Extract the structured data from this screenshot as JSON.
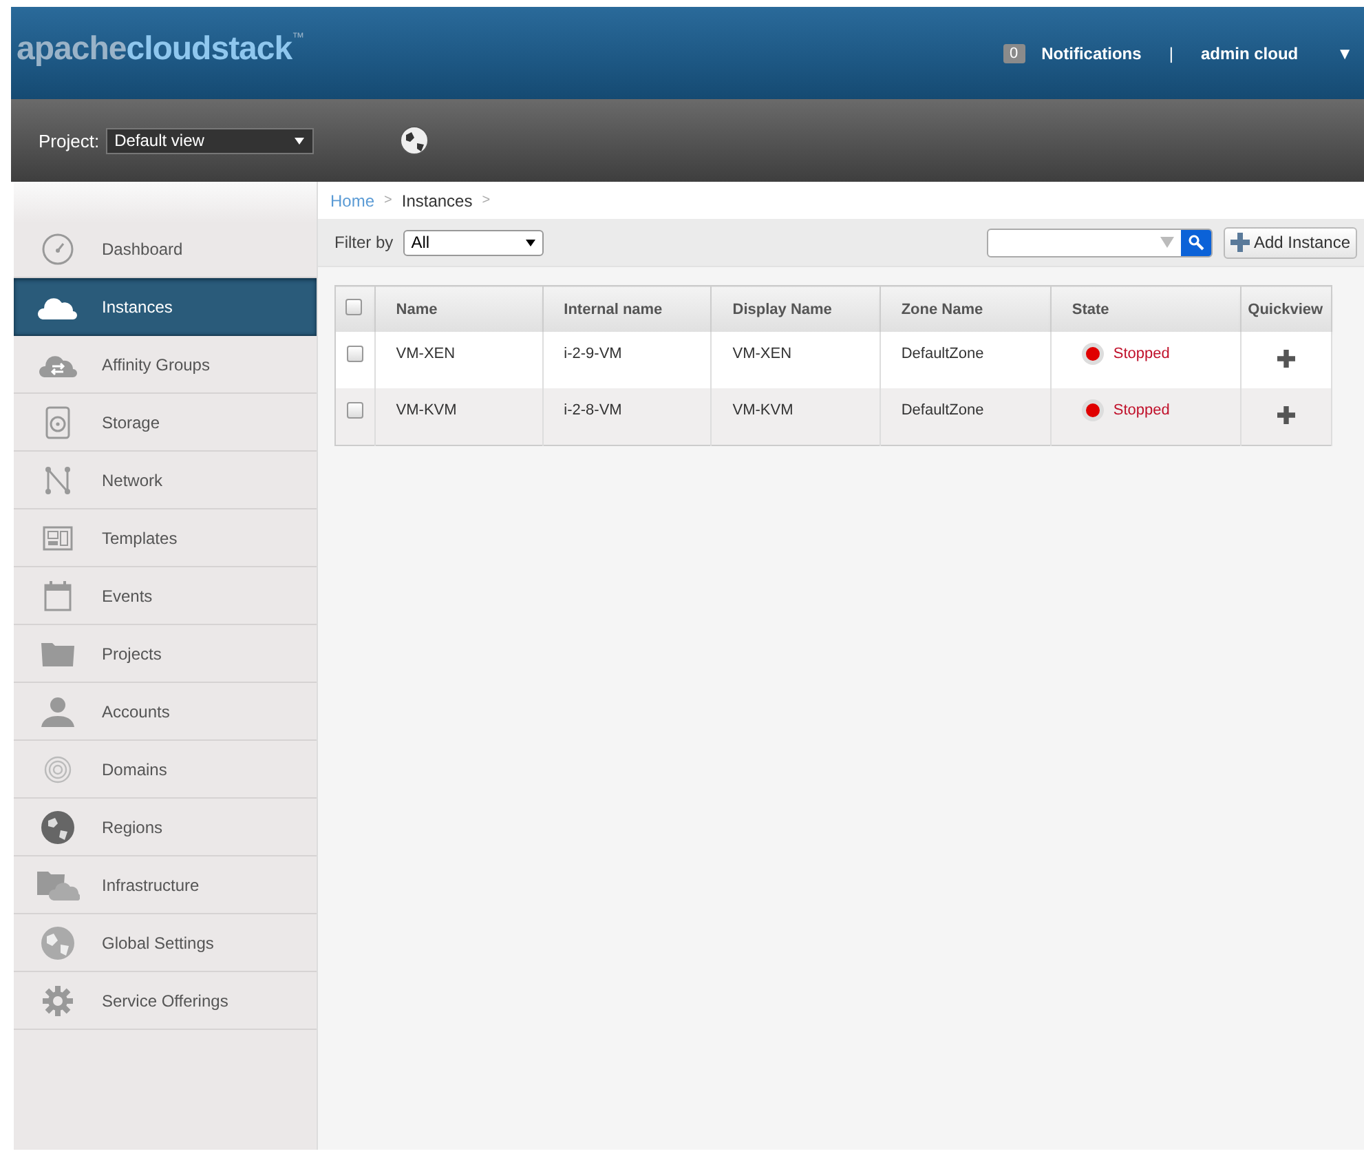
{
  "header": {
    "logo_light": "apache",
    "logo_bold": "cloudstack",
    "logo_mark": "™",
    "notification_count": "0",
    "notifications": "Notifications",
    "separator": "|",
    "user": "admin cloud",
    "menu_caret": "▼"
  },
  "project_bar": {
    "label": "Project:",
    "value": "Default view"
  },
  "sidebar": {
    "items": [
      {
        "label": "Dashboard",
        "selected": false
      },
      {
        "label": "Instances",
        "selected": true
      },
      {
        "label": "Affinity Groups",
        "selected": false
      },
      {
        "label": "Storage",
        "selected": false
      },
      {
        "label": "Network",
        "selected": false
      },
      {
        "label": "Templates",
        "selected": false
      },
      {
        "label": "Events",
        "selected": false
      },
      {
        "label": "Projects",
        "selected": false
      },
      {
        "label": "Accounts",
        "selected": false
      },
      {
        "label": "Domains",
        "selected": false
      },
      {
        "label": "Regions",
        "selected": false
      },
      {
        "label": "Infrastructure",
        "selected": false
      },
      {
        "label": "Global Settings",
        "selected": false
      },
      {
        "label": "Service Offerings",
        "selected": false
      }
    ]
  },
  "breadcrumb": [
    {
      "label": "Home",
      "link": true
    },
    {
      "label": "Instances",
      "link": false
    }
  ],
  "breadcrumb_separator": ">",
  "toolbar": {
    "filter_label": "Filter by",
    "filter_value": "All",
    "add_button": "Add Instance"
  },
  "table": {
    "columns": [
      "Name",
      "Internal name",
      "Display Name",
      "Zone Name",
      "State",
      "Quickview"
    ],
    "select_all_checked": false,
    "rows": [
      {
        "checked": false,
        "name": "VM-XEN",
        "internal_name": "i-2-9-VM",
        "display_name": "VM-XEN",
        "zone": "DefaultZone",
        "state": "Stopped",
        "color": "#e00000"
      },
      {
        "checked": false,
        "name": "VM-KVM",
        "internal_name": "i-2-8-VM",
        "display_name": "VM-KVM",
        "zone": "DefaultZone",
        "state": "Stopped",
        "color": "#e00000"
      }
    ]
  }
}
